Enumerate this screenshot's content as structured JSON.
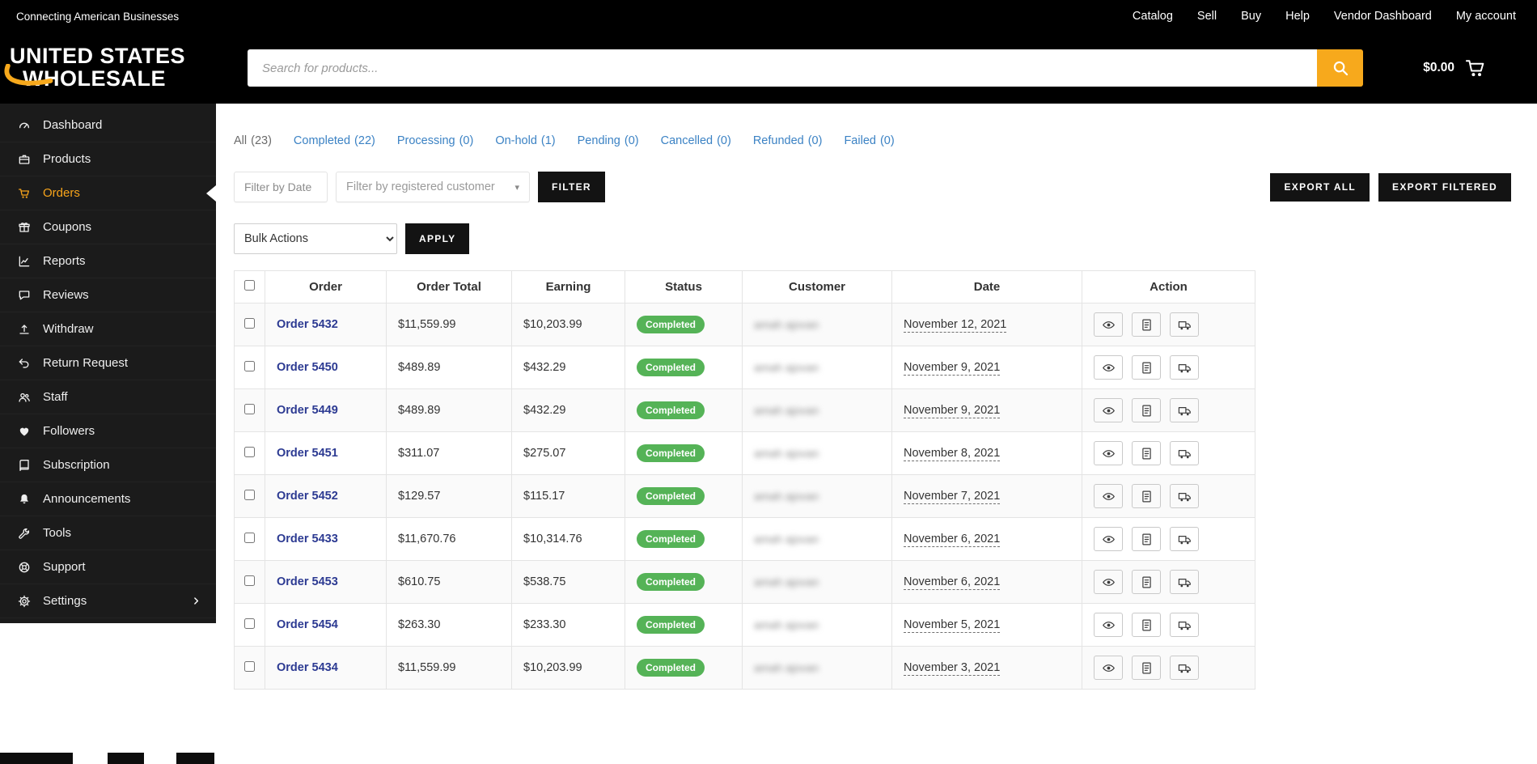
{
  "topbar": {
    "tagline": "Connecting American Businesses",
    "nav": [
      {
        "label": "Catalog"
      },
      {
        "label": "Sell"
      },
      {
        "label": "Buy"
      },
      {
        "label": "Help"
      },
      {
        "label": "Vendor Dashboard"
      },
      {
        "label": "My account"
      }
    ]
  },
  "header": {
    "logo": {
      "line1": "UNITED STATES",
      "line2": "WHOLESALE"
    },
    "search": {
      "placeholder": "Search for products...",
      "icon": "search-icon"
    },
    "cart": {
      "total": "$0.00",
      "icon": "cart-icon"
    }
  },
  "sidebar": {
    "items": [
      {
        "label": "Dashboard",
        "icon": "gauge-icon"
      },
      {
        "label": "Products",
        "icon": "briefcase-icon"
      },
      {
        "label": "Orders",
        "icon": "cart-icon",
        "active": true
      },
      {
        "label": "Coupons",
        "icon": "gift-icon"
      },
      {
        "label": "Reports",
        "icon": "chart-icon"
      },
      {
        "label": "Reviews",
        "icon": "comment-icon"
      },
      {
        "label": "Withdraw",
        "icon": "upload-icon"
      },
      {
        "label": "Return Request",
        "icon": "undo-icon"
      },
      {
        "label": "Staff",
        "icon": "users-icon"
      },
      {
        "label": "Followers",
        "icon": "heart-icon"
      },
      {
        "label": "Subscription",
        "icon": "book-icon"
      },
      {
        "label": "Announcements",
        "icon": "bell-icon"
      },
      {
        "label": "Tools",
        "icon": "wrench-icon"
      },
      {
        "label": "Support",
        "icon": "lifering-icon"
      },
      {
        "label": "Settings",
        "icon": "gear-icon",
        "has_submenu": true
      }
    ]
  },
  "orders_page": {
    "status_filters": [
      {
        "label": "All",
        "count": "(23)"
      },
      {
        "label": "Completed",
        "count": "(22)"
      },
      {
        "label": "Processing",
        "count": "(0)"
      },
      {
        "label": "On-hold",
        "count": "(1)"
      },
      {
        "label": "Pending",
        "count": "(0)"
      },
      {
        "label": "Cancelled",
        "count": "(0)"
      },
      {
        "label": "Refunded",
        "count": "(0)"
      },
      {
        "label": "Failed",
        "count": "(0)"
      }
    ],
    "filters": {
      "date_placeholder": "Filter by Date",
      "customer_placeholder": "Filter by registered customer",
      "filter_button": "FILTER",
      "export_all_button": "EXPORT ALL",
      "export_filtered_button": "EXPORT FILTERED"
    },
    "bulk": {
      "selected": "Bulk Actions",
      "apply_button": "APPLY"
    },
    "table": {
      "headers": {
        "order": "Order",
        "total": "Order Total",
        "earning": "Earning",
        "status": "Status",
        "customer": "Customer",
        "date": "Date",
        "action": "Action"
      },
      "action_icons": [
        "eye-icon",
        "invoice-icon",
        "truck-icon"
      ],
      "rows": [
        {
          "order": "Order 5432",
          "total": "$11,559.99",
          "earning": "$10,203.99",
          "status": "Completed",
          "customer": "amah ajovan",
          "date": "November 12, 2021"
        },
        {
          "order": "Order 5450",
          "total": "$489.89",
          "earning": "$432.29",
          "status": "Completed",
          "customer": "amah ajovan",
          "date": "November 9, 2021"
        },
        {
          "order": "Order 5449",
          "total": "$489.89",
          "earning": "$432.29",
          "status": "Completed",
          "customer": "amah ajovan",
          "date": "November 9, 2021"
        },
        {
          "order": "Order 5451",
          "total": "$311.07",
          "earning": "$275.07",
          "status": "Completed",
          "customer": "amah ajovan",
          "date": "November 8, 2021"
        },
        {
          "order": "Order 5452",
          "total": "$129.57",
          "earning": "$115.17",
          "status": "Completed",
          "customer": "amah ajovan",
          "date": "November 7, 2021"
        },
        {
          "order": "Order 5433",
          "total": "$11,670.76",
          "earning": "$10,314.76",
          "status": "Completed",
          "customer": "amah ajovan",
          "date": "November 6, 2021"
        },
        {
          "order": "Order 5453",
          "total": "$610.75",
          "earning": "$538.75",
          "status": "Completed",
          "customer": "amah ajovan",
          "date": "November 6, 2021"
        },
        {
          "order": "Order 5454",
          "total": "$263.30",
          "earning": "$233.30",
          "status": "Completed",
          "customer": "amah ajovan",
          "date": "November 5, 2021"
        },
        {
          "order": "Order 5434",
          "total": "$11,559.99",
          "earning": "$10,203.99",
          "status": "Completed",
          "customer": "amah ajovan",
          "date": "November 3, 2021"
        }
      ]
    }
  },
  "colors": {
    "accent_yellow": "#f7a91c",
    "link_blue": "#3b82c4",
    "order_link_navy": "#2c3a92",
    "badge_green": "#55b357",
    "bar_black": "#000000",
    "sidebar_dark": "#1b1b1b"
  }
}
